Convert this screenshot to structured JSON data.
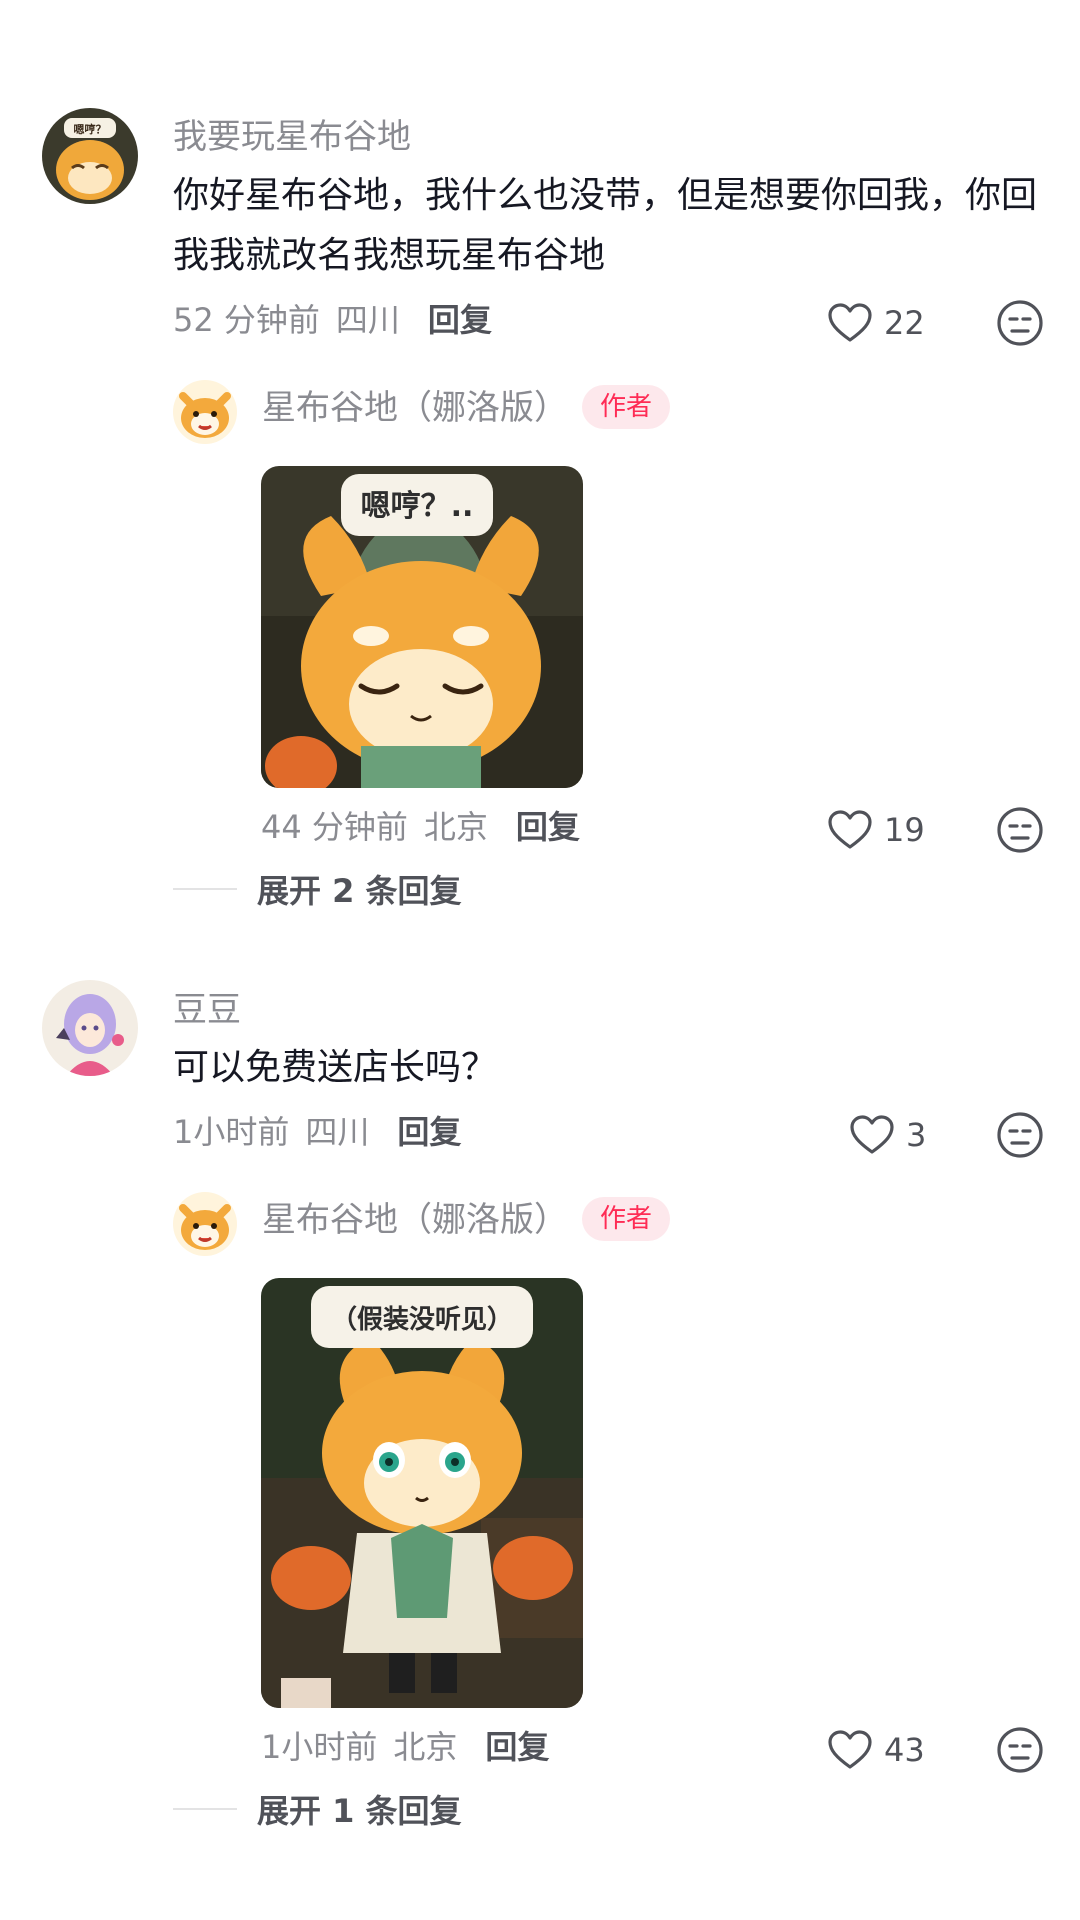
{
  "comments": [
    {
      "username": "我要玩星布谷地",
      "text": "你好星布谷地，我什么也没带，但是想要你回我，你回我我就改名我想玩星布谷地",
      "time": "52 分钟前",
      "location": "四川",
      "reply_label": "回复",
      "likes": "22",
      "avatar_caption": "嗯哼？",
      "reply": {
        "username": "星布谷地（娜洛版）",
        "badge": "作者",
        "sticker_caption": "嗯哼？..",
        "time": "44 分钟前",
        "location": "北京",
        "reply_label": "回复",
        "likes": "19",
        "expand_label": "展开 2 条回复"
      }
    },
    {
      "username": "豆豆",
      "text": "可以免费送店长吗？",
      "time": "1小时前",
      "location": "四川",
      "reply_label": "回复",
      "likes": "3",
      "reply": {
        "username": "星布谷地（娜洛版）",
        "badge": "作者",
        "sticker_caption": "（假装没听见）",
        "time": "1小时前",
        "location": "北京",
        "reply_label": "回复",
        "likes": "43",
        "expand_label": "展开 1 条回复"
      }
    }
  ],
  "colors": {
    "accent": "#fe2c55",
    "badge_bg": "#fde8ec",
    "meta_text": "#8a8b91",
    "primary_text": "#161823"
  },
  "icons": [
    "heart-outline-icon",
    "neutral-face-icon"
  ]
}
